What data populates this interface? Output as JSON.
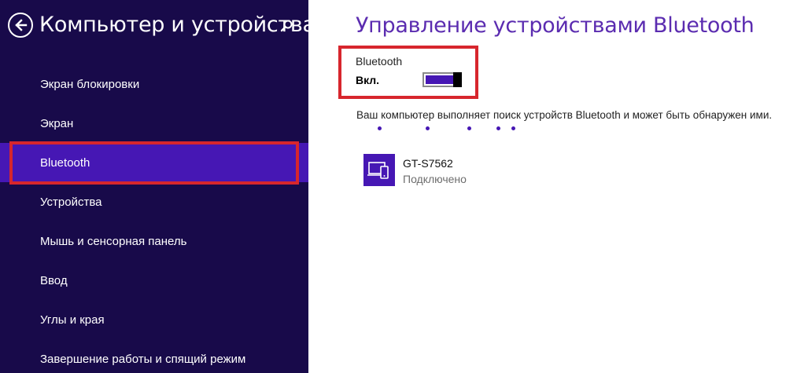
{
  "sidebar": {
    "title": "Компьютер и устройства",
    "items": [
      {
        "label": "Экран блокировки"
      },
      {
        "label": "Экран"
      },
      {
        "label": "Bluetooth"
      },
      {
        "label": "Устройства"
      },
      {
        "label": "Мышь и сенсорная панель"
      },
      {
        "label": "Ввод"
      },
      {
        "label": "Углы и края"
      },
      {
        "label": "Завершение работы и спящий режим"
      }
    ],
    "active_index": 2
  },
  "main": {
    "title": "Управление устройствами Bluetooth",
    "bluetooth_toggle": {
      "label": "Bluetooth",
      "state": "Вкл.",
      "on": true
    },
    "search_message": "Ваш компьютер выполняет поиск устройств Bluetooth и может быть обнаружен ими.",
    "devices": [
      {
        "name": "GT-S7562",
        "status": "Подключено",
        "icon": "phone-laptop-icon"
      }
    ]
  },
  "colors": {
    "sidebar_bg": "#180a4a",
    "accent": "#4617b4",
    "title": "#5b2cb0",
    "highlight": "#d7262d"
  },
  "icons": [
    "back-arrow-icon",
    "search-icon",
    "phone-laptop-icon"
  ]
}
